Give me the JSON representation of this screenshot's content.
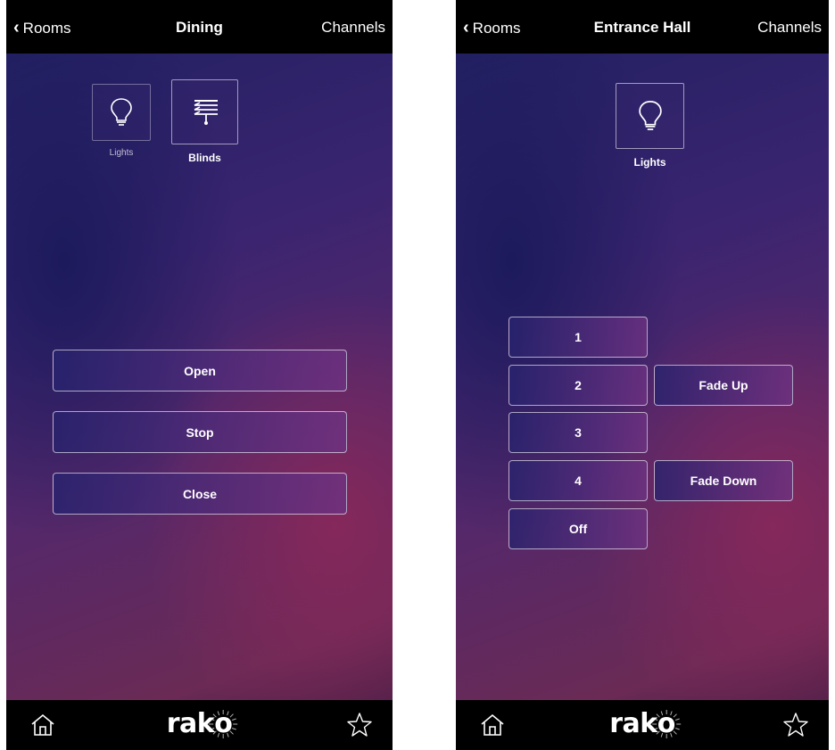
{
  "left": {
    "back_label": "Rooms",
    "title": "Dining",
    "channels_label": "Channels",
    "categories": [
      {
        "label": "Lights",
        "icon": "bulb-icon"
      },
      {
        "label": "Blinds",
        "icon": "blinds-icon"
      }
    ],
    "buttons": [
      "Open",
      "Stop",
      "Close"
    ]
  },
  "right": {
    "back_label": "Rooms",
    "title": "Entrance Hall",
    "channels_label": "Channels",
    "categories": [
      {
        "label": "Lights",
        "icon": "bulb-icon"
      }
    ],
    "scenes": [
      "1",
      "2",
      "3",
      "4",
      "Off"
    ],
    "fade": [
      "Fade Up",
      "Fade Down"
    ]
  },
  "tabbar": {
    "logo_text_a": "rak",
    "logo_text_b": "o",
    "home_icon": "home-icon",
    "favorites_icon": "star-icon"
  }
}
